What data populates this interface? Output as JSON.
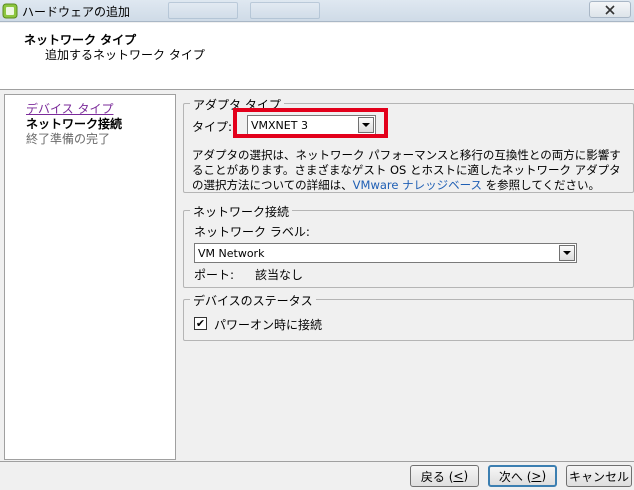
{
  "window": {
    "title": "ハードウェアの追加"
  },
  "header": {
    "title": "ネットワーク タイプ",
    "subtitle": "追加するネットワーク タイプ"
  },
  "nav": {
    "items": [
      {
        "label": "デバイス タイプ",
        "state": "visited"
      },
      {
        "label": "ネットワーク接続",
        "state": "current"
      },
      {
        "label": "終了準備の完了",
        "state": "pending"
      }
    ]
  },
  "adapter_type": {
    "legend": "アダプタ タイプ",
    "type_label": "タイプ:",
    "selected": "VMXNET 3",
    "description_part1": "アダプタの選択は、ネットワーク パフォーマンスと移行の互換性との両方に影響することがあります。さまざまなゲスト OS とホストに適したネットワーク アダプタの選択方法についての詳細は、",
    "description_link": "VMware ナレッジベース",
    "description_part2": " を参照してください。"
  },
  "network_connection": {
    "legend": "ネットワーク接続",
    "network_label": "ネットワーク ラベル:",
    "selected_network": "VM Network",
    "port_label": "ポート:",
    "port_value": "該当なし"
  },
  "device_status": {
    "legend": "デバイスのステータス",
    "power_on_label": "パワーオン時に接続",
    "power_on_checked": "✔"
  },
  "buttons": {
    "back": "戻る (",
    "back_key": "<",
    "back_end": ")",
    "next": "次へ (",
    "next_key": ">",
    "next_end": ")",
    "cancel": "キャンセル"
  },
  "colors": {
    "highlight": "#e3001b",
    "link": "#1f5fb4",
    "visited_link": "#7b2b9a"
  }
}
